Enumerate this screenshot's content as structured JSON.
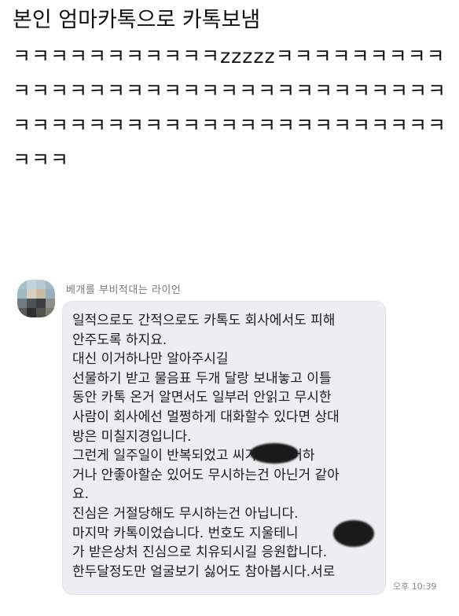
{
  "post": {
    "title": "본인 엄마카톡으로 카톡보냄",
    "body": "ㅋㅋㅋㅋㅋㅋㅋㅋㅋㅋㅋzzzzzㅋㅋㅋㅋㅋㅋㅋㅋㅋㅋㅋㅋㅋㅋㅋㅋㅋㅋㅋㅋㅋㅋㅋㅋㅋㅋㅋㅋㅋㅋㅋㅋㅋㅋㅋㅋㅋㅋㅋㅋㅋㅋㅋㅋㅋㅋㅋㅋㅋㅋㅋㅋㅋㅋㅋㅋㅋㅋ"
  },
  "chat": {
    "sender": "베개를 부비적대는 라이언",
    "message_lines": [
      "일적으로도 간적으로도 카톡도 회사에서도 피해",
      "안주도록 하지요.",
      "대신 이거하나만 알아주시길",
      "선물하기 받고 물음표 두개 달랑 보내놓고 이틀",
      "동안 카톡 온거 알면서도 일부러 안읽고 무시한",
      "사람이 회사에선 멀쩡하게 대화할수 있다면 상대",
      "방은 미칠지경입니다.",
      "그런게 일주일이 반복되었고      씨가 날 싫어하",
      "거나 안좋아할순 있어도 무시하는건 아닌거 같아",
      "요.",
      "진심은 거절당해도 무시하는건 아닙니다.",
      "마지막 카톡이었습니다. 번호도 지울테니      ",
      "가 받은상처 진심으로 치유되시길 응원합니다.",
      "한두달정도만 얼굴보기 싫어도 참아봅시다.서로"
    ],
    "timestamp": "오후 10:39"
  }
}
